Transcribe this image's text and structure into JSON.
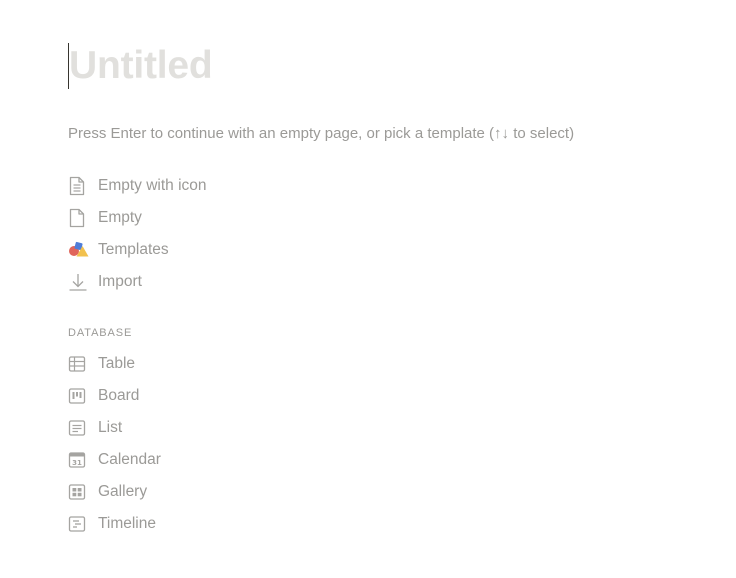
{
  "page": {
    "title_placeholder": "Untitled",
    "hint": "Press Enter to continue with an empty page, or pick a template (↑↓ to select)"
  },
  "options": [
    {
      "label": "Empty with icon",
      "icon": "document-lines-icon"
    },
    {
      "label": "Empty",
      "icon": "blank-document-icon"
    },
    {
      "label": "Templates",
      "icon": "templates-shapes-icon"
    },
    {
      "label": "Import",
      "icon": "download-arrow-icon"
    }
  ],
  "database": {
    "header": "DATABASE",
    "items": [
      {
        "label": "Table",
        "icon": "table-icon"
      },
      {
        "label": "Board",
        "icon": "board-icon"
      },
      {
        "label": "List",
        "icon": "list-icon"
      },
      {
        "label": "Calendar",
        "icon": "calendar-icon"
      },
      {
        "label": "Gallery",
        "icon": "gallery-icon"
      },
      {
        "label": "Timeline",
        "icon": "timeline-icon"
      }
    ]
  },
  "colors": {
    "muted_text": "#9b9a97",
    "placeholder": "#e1e0dd",
    "icon_stroke": "#a5a4a1"
  }
}
